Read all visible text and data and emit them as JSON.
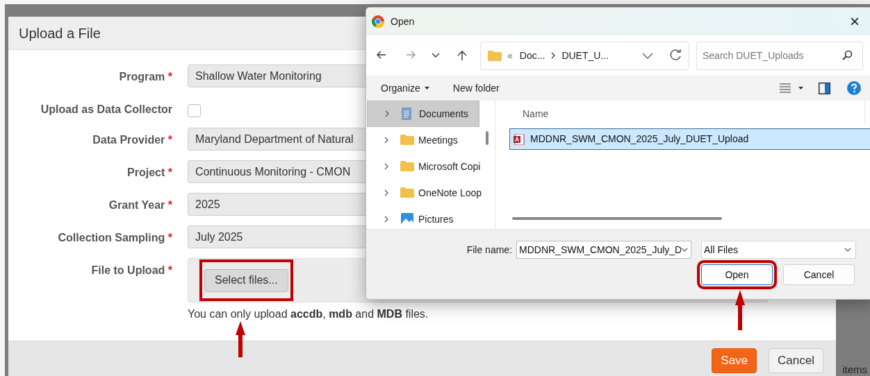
{
  "background": {
    "text": "items"
  },
  "upload_dialog": {
    "title": "Upload a File",
    "fields": [
      {
        "kind": "select",
        "label": "Program",
        "required": true,
        "value": "Shallow Water Monitoring"
      },
      {
        "kind": "checkbox",
        "label": "Upload as Data Collector",
        "required": false,
        "checked": false
      },
      {
        "kind": "select",
        "label": "Data Provider",
        "required": true,
        "value": "Maryland Department of Natural"
      },
      {
        "kind": "select",
        "label": "Project",
        "required": true,
        "value": "Continuous Monitoring - CMON"
      },
      {
        "kind": "select",
        "label": "Grant Year",
        "required": true,
        "value": "2025"
      },
      {
        "kind": "select",
        "label": "Collection Sampling",
        "required": true,
        "value": "July 2025"
      },
      {
        "kind": "file",
        "label": "File to Upload",
        "required": true,
        "button": "Select files...",
        "highlighted": true
      }
    ],
    "required_mark": "*",
    "hint": "You can only upload **accdb**, **mdb** and **MDB** files.",
    "buttons": [
      {
        "kind": "primary",
        "label": "Save"
      },
      {
        "kind": "secondary",
        "label": "Cancel"
      }
    ]
  },
  "open_dialog": {
    "title": "Open",
    "close": "×",
    "path": {
      "overflow": "«",
      "crumbs": [
        "Doc...",
        "DUET_U..."
      ]
    },
    "search": {
      "placeholder": "Search DUET_Uploads"
    },
    "toolbar": {
      "organize": "Organize",
      "new_folder": "New folder"
    },
    "nav_items": [
      {
        "kind": "documents",
        "label": "Documents",
        "selected": true
      },
      {
        "kind": "folder",
        "label": "Meetings",
        "selected": false
      },
      {
        "kind": "folder",
        "label": "Microsoft Copi",
        "selected": false
      },
      {
        "kind": "folder",
        "label": "OneNote Loop",
        "selected": false
      },
      {
        "kind": "pictures",
        "label": "Pictures",
        "selected": false
      }
    ],
    "column": "Name",
    "files": [
      {
        "name": "MDDNR_SWM_CMON_2025_July_DUET_Upload",
        "selected": true
      }
    ],
    "file_name_label": "File name:",
    "file_name": "MDDNR_SWM_CMON_2025_July_D",
    "file_type": "All Files",
    "buttons": [
      {
        "kind": "primary",
        "label": "Open",
        "highlighted": true
      },
      {
        "kind": "secondary",
        "label": "Cancel",
        "highlighted": false
      }
    ]
  }
}
